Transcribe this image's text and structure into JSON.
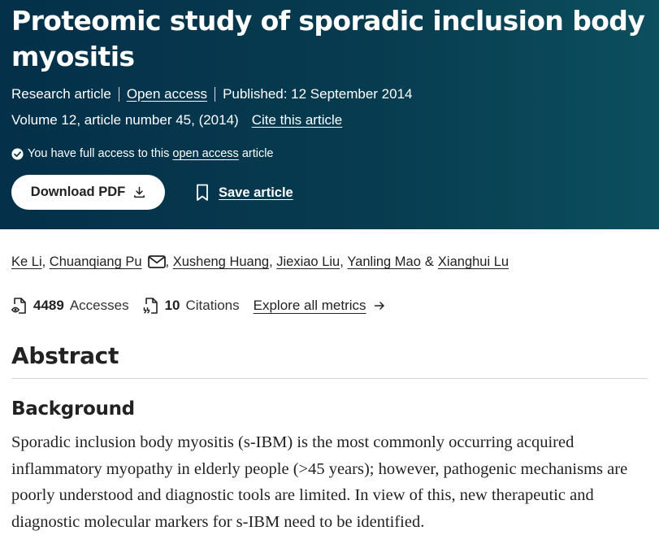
{
  "header": {
    "title": "Proteomic study of sporadic inclusion body myositis",
    "article_type": "Research article",
    "open_access_label": "Open access",
    "published": "Published: 12 September 2014",
    "volume_info": "Volume 12, article number 45, (2014)",
    "cite_label": "Cite this article",
    "access_prefix": "You have full access to this",
    "access_link": "open access",
    "access_suffix": "article",
    "download_label": "Download PDF",
    "save_label": "Save article",
    "background_color": "#073b4f"
  },
  "authors": {
    "list": [
      "Ke Li",
      "Chuanqiang Pu",
      "Xusheng Huang",
      "Jiexiao Liu",
      "Yanling Mao",
      "Xianghui Lu"
    ],
    "ampersand": "&"
  },
  "metrics": {
    "accesses_count": "4489",
    "accesses_label": "Accesses",
    "citations_count": "10",
    "citations_label": "Citations",
    "explore_label": "Explore all metrics"
  },
  "abstract": {
    "heading": "Abstract",
    "section_heading": "Background",
    "text": "Sporadic inclusion body myositis (s-IBM) is the most commonly occurring acquired inflammatory myopathy in elderly people (>45 years); however, pathogenic mechanisms are poorly understood and diagnostic tools are limited. In view of this, new therapeutic and diagnostic molecular markers for s-IBM need to be identified."
  },
  "icons": {
    "check": "check-circle-icon",
    "download": "download-icon",
    "bookmark": "bookmark-icon",
    "mail": "mail-icon",
    "accesses": "document-eye-icon",
    "citations": "document-quote-icon",
    "arrow": "arrow-right-icon"
  }
}
